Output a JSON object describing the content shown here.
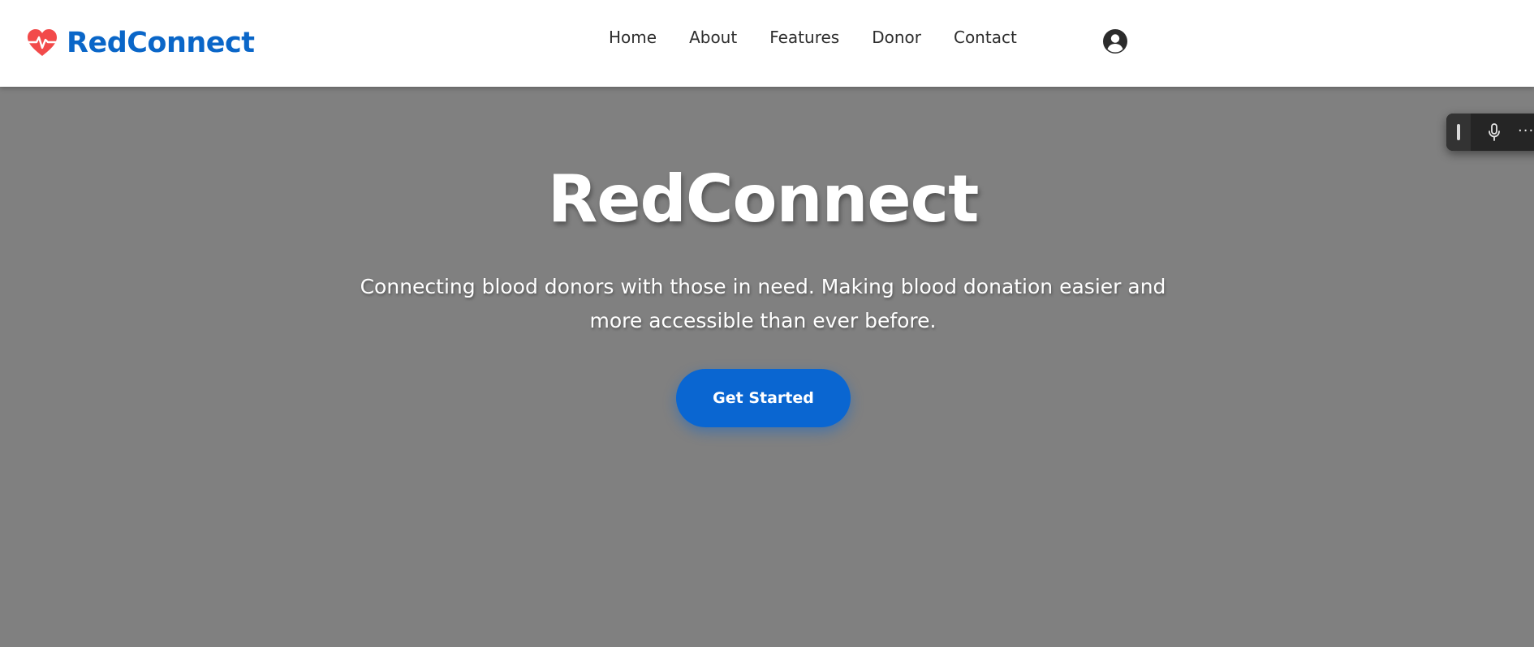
{
  "brand": {
    "name": "RedConnect",
    "icon": "heart-pulse-icon",
    "color": "#0a66c8",
    "icon_color": "#f24a4a"
  },
  "nav": {
    "items": [
      {
        "label": "Home"
      },
      {
        "label": "About"
      },
      {
        "label": "Features"
      },
      {
        "label": "Donor"
      },
      {
        "label": "Contact"
      }
    ],
    "user_icon": "user-circle-icon"
  },
  "hero": {
    "title": "RedConnect",
    "subtitle": "Connecting blood donors with those in need. Making blood donation easier and more accessible than ever before.",
    "cta_label": "Get Started",
    "background": "#808080",
    "cta_color": "#0a66d1"
  },
  "floating_toolbar": {
    "mic_icon": "microphone-icon",
    "more_label": "···"
  }
}
